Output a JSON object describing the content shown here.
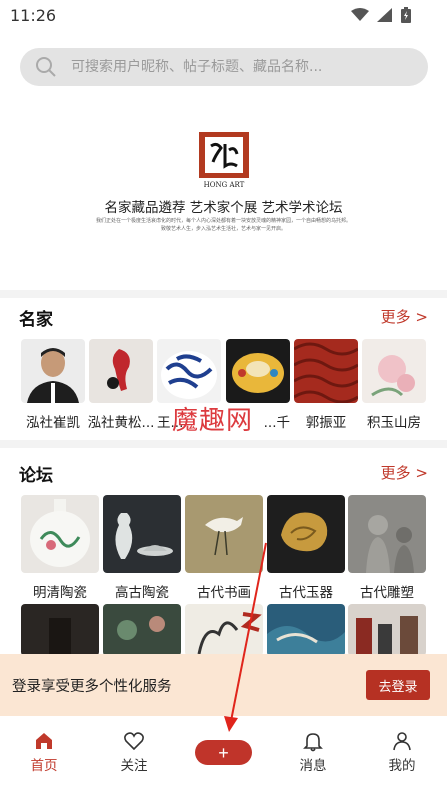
{
  "status_bar": {
    "time": "11:26"
  },
  "search": {
    "placeholder": "可搜索用户昵称、帖子标题、藏品名称..."
  },
  "banner": {
    "logo_caption": "HONG ART",
    "tagline": "名家藏品遴荐 艺术家个展 艺术学术论坛",
    "desc_line1": "我们正处在一个极度生活哀虑化的时代，每个人内心深处都有着一块安放灵魂的精神家园，一个自由畅想的乌托邦。",
    "desc_line2": "致敬艺术人生，步入泓艺术生活社，艺术与家一见开启。"
  },
  "famous": {
    "title": "名家",
    "more": "更多 >",
    "items": [
      {
        "label": "泓社崔凯"
      },
      {
        "label": "泓社黄松..."
      },
      {
        "label": "王..."
      },
      {
        "label": "...千"
      },
      {
        "label": "郭振亚"
      },
      {
        "label": "积玉山房"
      }
    ]
  },
  "forum": {
    "title": "论坛",
    "more": "更多 >",
    "items": [
      {
        "label": "明清陶瓷"
      },
      {
        "label": "高古陶瓷"
      },
      {
        "label": "古代书画"
      },
      {
        "label": "古代玉器"
      },
      {
        "label": "古代雕塑"
      }
    ]
  },
  "watermark": "魔趣网",
  "login_bar": {
    "text": "登录享受更多个性化服务",
    "button": "去登录"
  },
  "tabbar": {
    "home": "首页",
    "follow": "关注",
    "add": "+",
    "messages": "消息",
    "mine": "我的"
  },
  "colors": {
    "accent": "#c0392b",
    "login_bg": "#fbe6d3"
  }
}
